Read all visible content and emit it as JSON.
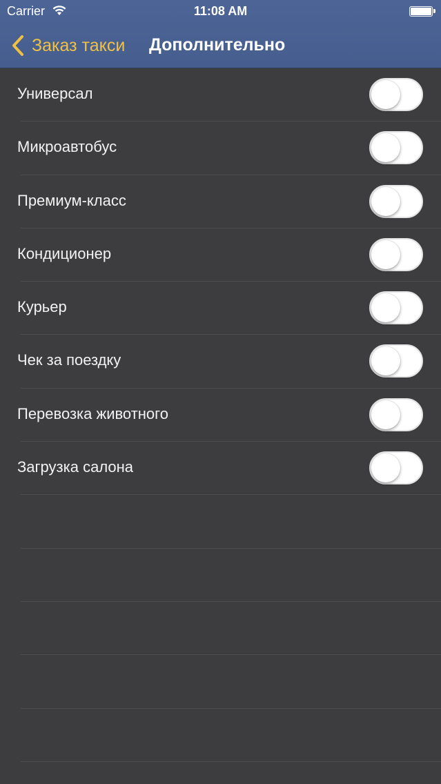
{
  "status_bar": {
    "carrier": "Carrier",
    "time": "11:08 AM",
    "wifi_icon": "wifi-icon",
    "battery_icon": "battery-icon"
  },
  "nav": {
    "back_label": "Заказ такси",
    "back_icon": "chevron-back-icon",
    "title": "Дополнительно"
  },
  "colors": {
    "header_bg": "#4a6291",
    "accent": "#f0c045",
    "list_bg": "#3d3d3f"
  },
  "options": [
    {
      "label": "Универсал",
      "enabled": false
    },
    {
      "label": "Микроавтобус",
      "enabled": false
    },
    {
      "label": "Премиум-класс",
      "enabled": false
    },
    {
      "label": "Кондиционер",
      "enabled": false
    },
    {
      "label": "Курьер",
      "enabled": false
    },
    {
      "label": "Чек за поездку",
      "enabled": false
    },
    {
      "label": "Перевозка животного",
      "enabled": false
    },
    {
      "label": "Загрузка салона",
      "enabled": false
    }
  ]
}
